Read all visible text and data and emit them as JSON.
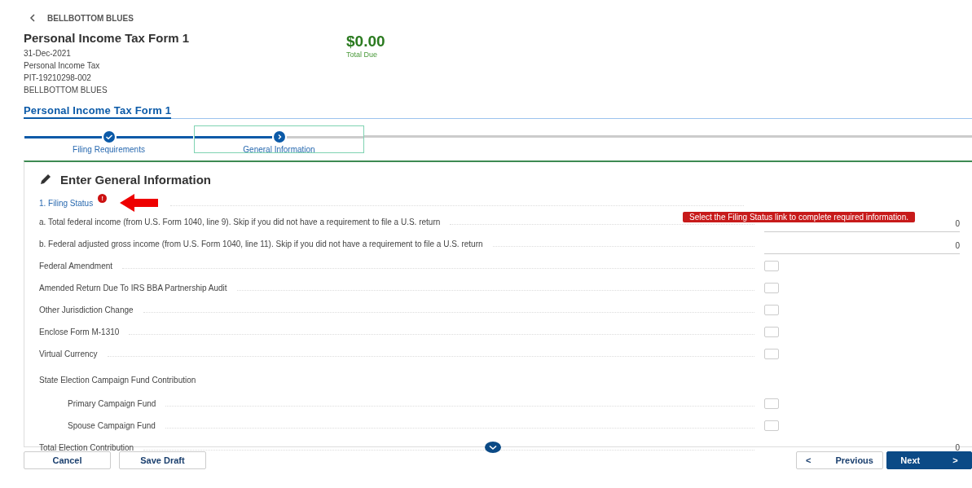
{
  "back_link": {
    "label": "BELLBOTTOM BLUES"
  },
  "header": {
    "title": "Personal Income Tax Form 1",
    "details": [
      "31-Dec-2021",
      "Personal Income Tax",
      "PIT-19210298-002",
      "BELLBOTTOM BLUES"
    ],
    "total": {
      "amount": "$0.00",
      "label": "Total Due"
    }
  },
  "form_tab": {
    "label": "Personal Income Tax Form 1"
  },
  "steps": [
    {
      "label": "Filing Requirements",
      "completed": true,
      "selected": false
    },
    {
      "label": "General Information",
      "completed": false,
      "selected": true
    }
  ],
  "section": {
    "title": "Enter General Information",
    "link": {
      "label": "1. Filing Status",
      "error_badge": "!"
    },
    "error_tooltip": "Select the Filing Status link to complete required information.",
    "rows": [
      {
        "kind": "amount",
        "label": "a. Total federal income (from U.S. Form 1040, line 9). Skip if you did not have a requirement to file a U.S. return",
        "value": "0"
      },
      {
        "kind": "amount",
        "label": "b. Federal adjusted gross income (from U.S. Form 1040, line 11). Skip if you did not have a requirement to file a U.S. return",
        "value": "0"
      },
      {
        "kind": "checkbox",
        "label": "Federal Amendment",
        "checked": false
      },
      {
        "kind": "checkbox",
        "label": "Amended Return Due To IRS BBA Partnership Audit",
        "checked": false
      },
      {
        "kind": "checkbox",
        "label": "Other Jurisdiction Change",
        "checked": false
      },
      {
        "kind": "checkbox",
        "label": "Enclose Form M-1310",
        "checked": false
      },
      {
        "kind": "checkbox",
        "label": "Virtual Currency",
        "checked": false
      },
      {
        "kind": "group",
        "label": "State Election Campaign Fund Contribution",
        "children": [
          {
            "kind": "checkbox",
            "label": "Primary Campaign Fund",
            "checked": false
          },
          {
            "kind": "checkbox",
            "label": "Spouse Campaign Fund",
            "checked": false
          }
        ]
      },
      {
        "kind": "total",
        "label": "Total Election Contribution",
        "value": "0"
      }
    ]
  },
  "footer": {
    "left_buttons": [
      "Cancel",
      "Save Draft"
    ],
    "previous": {
      "icon": "<",
      "label": "Previous"
    },
    "next": {
      "label": "Next",
      "icon": ">"
    }
  }
}
